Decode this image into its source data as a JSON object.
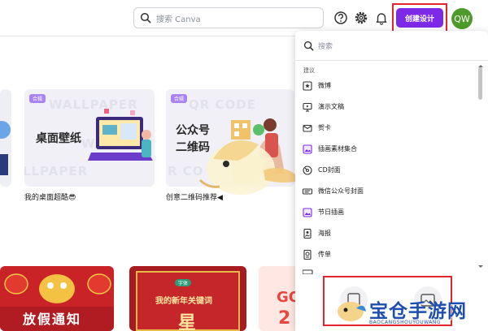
{
  "header": {
    "search_placeholder": "搜索 Canva",
    "create_button": "创建设计",
    "avatar_initials": "QW"
  },
  "cards": [
    {
      "badge": "合辑",
      "watermark": [
        "WALLPAPER",
        "WALL",
        "LLPAPER"
      ],
      "title_line1": "桌面壁纸",
      "caption": "我的桌面超酷😎"
    },
    {
      "badge": "合辑",
      "watermark": [
        "QR CODE",
        "R CO"
      ],
      "title_line1": "公众号",
      "title_line2": "二维码",
      "caption": "创意二维码推荐◀"
    }
  ],
  "posters": [
    {
      "text": "放假通知"
    },
    {
      "tag": "字体",
      "text": "我的新年关键词",
      "big": "星"
    },
    {
      "text": "GO",
      "number": "2"
    }
  ],
  "panel": {
    "search_placeholder": "搜索",
    "suggestions_label": "建议",
    "items": [
      {
        "label": "微博",
        "icon": "weibo-icon"
      },
      {
        "label": "演示文稿",
        "icon": "presentation-icon"
      },
      {
        "label": "贺卡",
        "icon": "card-icon"
      },
      {
        "label": "插画素材集合",
        "icon": "illustration-icon"
      },
      {
        "label": "CD封面",
        "icon": "cd-icon"
      },
      {
        "label": "微信公众号封面",
        "icon": "wechat-cover-icon"
      },
      {
        "label": "节日插画",
        "icon": "festival-icon"
      },
      {
        "label": "海报",
        "icon": "poster-icon"
      },
      {
        "label": "传单",
        "icon": "flyer-icon"
      }
    ]
  },
  "watermark": {
    "site_name": "宝仓手游网",
    "site_domain": "BAOCANGSHOUYOUWANG"
  },
  "colors": {
    "accent": "#7d2ae8",
    "highlight": "#e4252d",
    "avatar": "#4d9b2a"
  }
}
